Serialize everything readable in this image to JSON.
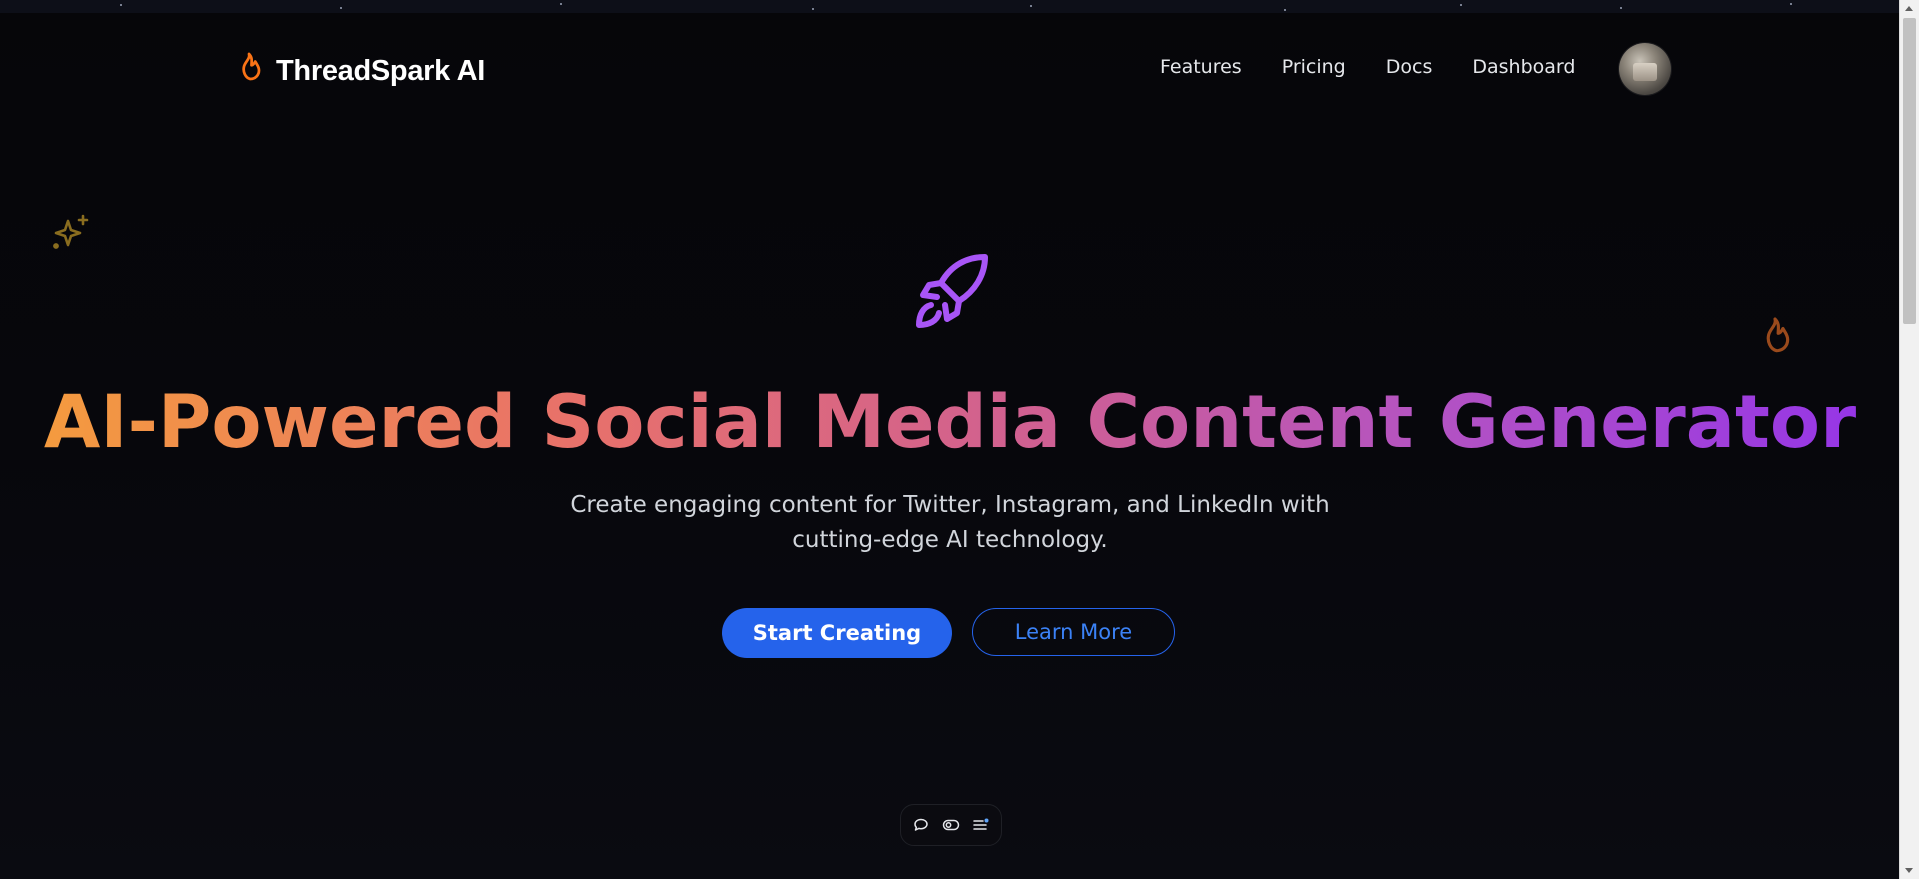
{
  "brand": {
    "name": "ThreadSpark AI",
    "logo_icon": "flame-icon",
    "accent": "#f97316"
  },
  "nav": {
    "links": [
      {
        "label": "Features"
      },
      {
        "label": "Pricing"
      },
      {
        "label": "Docs"
      },
      {
        "label": "Dashboard"
      }
    ],
    "avatar_icon": "user-avatar"
  },
  "hero": {
    "icon": "rocket-icon",
    "icon_color": "#a855f7",
    "headline": "AI-Powered Social Media Content Generator",
    "headline_gradient": [
      "#f59e3b",
      "#e8716a",
      "#cf5f93",
      "#b453c2",
      "#9333ea"
    ],
    "subtitle_line1": "Create engaging content for Twitter, Instagram, and LinkedIn with",
    "subtitle_line2": "cutting-edge AI technology.",
    "primary_cta": "Start Creating",
    "secondary_cta": "Learn More",
    "cta_color": "#2563eb"
  },
  "decorations": {
    "left": {
      "icon": "sparkle-icon",
      "color": "#8a6d1f"
    },
    "right": {
      "icon": "flame-icon",
      "color": "#9a4a1c"
    }
  },
  "floating_toolbar": {
    "buttons": [
      {
        "icon": "chat-bubble-icon"
      },
      {
        "icon": "toggle-icon"
      },
      {
        "icon": "menu-list-icon"
      }
    ]
  }
}
